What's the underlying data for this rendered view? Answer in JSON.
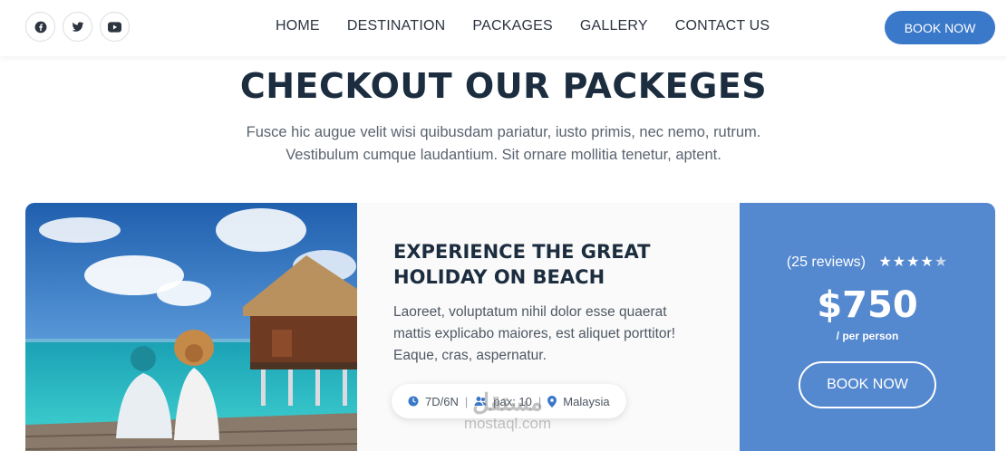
{
  "header": {
    "socials": [
      {
        "icon": "facebook-icon"
      },
      {
        "icon": "twitter-icon"
      },
      {
        "icon": "youtube-icon"
      }
    ],
    "nav": [
      "HOME",
      "DESTINATION",
      "PACKAGES",
      "GALLERY",
      "CONTACT US"
    ],
    "cta": "BOOK NOW"
  },
  "section": {
    "title": "CHECKOUT OUR PACKEGES",
    "subtitle": "Fusce hic augue velit wisi quibusdam pariatur, iusto primis, nec nemo, rutrum. Vestibulum cumque laudantium. Sit ornare mollitia tenetur, aptent."
  },
  "package": {
    "title": "EXPERIENCE THE GREAT HOLIDAY ON BEACH",
    "description": "Laoreet, voluptatum nihil dolor esse quaerat mattis explicabo maiores, est aliquet porttitor! Eaque, cras, aspernatur.",
    "duration": "7D/6N",
    "pax": "pax: 10",
    "location": "Malaysia",
    "reviews": "(25 reviews)",
    "rating": 4,
    "rating_max": 5,
    "price": "$750",
    "per": "/ per person",
    "cta": "BOOK NOW"
  },
  "colors": {
    "accent": "#3a78c9",
    "price_panel": "#5488cf",
    "heading": "#1c2d3f"
  },
  "watermark": {
    "arabic": "مستقل",
    "latin": "mostaql.com"
  }
}
